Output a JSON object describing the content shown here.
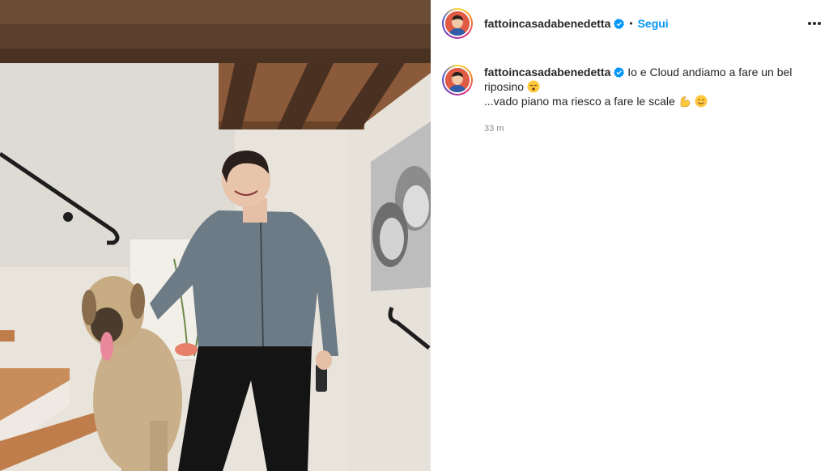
{
  "post": {
    "username": "fattoincasadabenedetta",
    "verified_icon": "verified-badge-icon",
    "separator": "•",
    "follow_label": "Segui",
    "caption_line1": "Io e Cloud andiamo a fare un bel riposino",
    "caption_line2": "...vado piano ma riesco a fare le scale",
    "timestamp": "33 m"
  },
  "colors": {
    "accent": "#0095f6",
    "text": "#262626",
    "muted": "#8e8e8e"
  },
  "icons": [
    "more-options-icon",
    "verified-badge-icon",
    "sleepy-face-emoji",
    "flexed-biceps-emoji",
    "smiling-face-emoji"
  ]
}
